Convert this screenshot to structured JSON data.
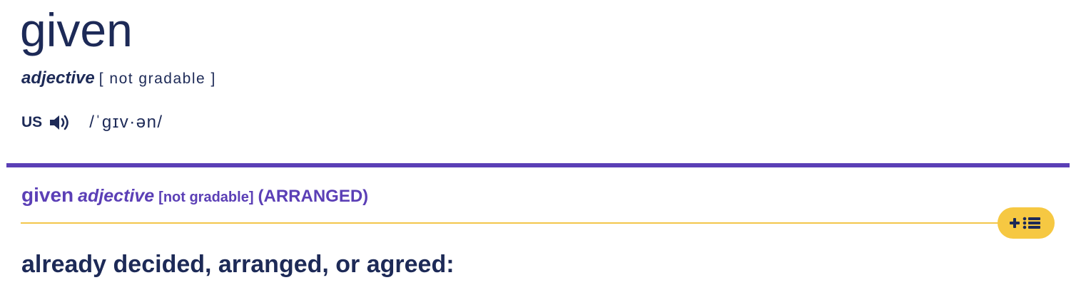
{
  "entry": {
    "headword": "given",
    "part_of_speech": "adjective",
    "grammar": "[ not gradable ]",
    "pronunciation": {
      "region": "US",
      "ipa": "/ˈɡɪv·ən/",
      "audio_icon": "speaker-icon"
    }
  },
  "sense": {
    "word": "given",
    "part_of_speech": "adjective",
    "grammar": "[not gradable]",
    "guideword": "(ARRANGED)",
    "definition": "already decided, arranged, or agreed:",
    "add_to_list_icon": "plus-list-icon"
  },
  "colors": {
    "primary_text": "#1d2a57",
    "accent_purple": "#5b3fb6",
    "accent_yellow": "#f6c842",
    "divider_yellow": "#f3c64a"
  }
}
